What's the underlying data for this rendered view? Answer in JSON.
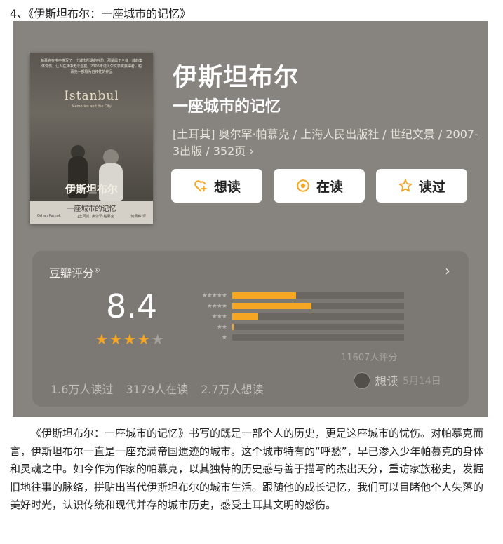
{
  "heading": "4、《伊斯坦布尔：一座城市的记忆》",
  "book": {
    "title": "伊斯坦布尔",
    "subtitle": "一座城市的记忆",
    "meta": "[土耳其] 奥尔罕·帕慕克 / 上海人民出版社 / 世纪文景 / 2007-3出版 / 352页",
    "meta_chevron": "›"
  },
  "cover": {
    "blurb": "帕慕克在书中描写了一个城市所谓的呼愁，那是属于全体一城的集体忧伤，让人在其中无法自拔。2006年诺贝尔文学奖获得者，帕慕克一部极为自传性的作品",
    "latin_title": "Istanbul",
    "latin_sub": "Memories and the City",
    "title": "伊斯坦布尔",
    "subtitle": "一座城市的记忆",
    "author_en": "Orhan Pamuk",
    "author_cn": "[土耳其] 奥尔罕·帕慕克",
    "translator": "何佩桦 译"
  },
  "buttons": [
    {
      "label": "想读",
      "icon": "heart-plus-icon"
    },
    {
      "label": "在读",
      "icon": "target-icon"
    },
    {
      "label": "读过",
      "icon": "star-outline-icon"
    }
  ],
  "rating": {
    "label": "豆瓣评分",
    "label_mark": "®",
    "chevron": "›",
    "score": "8.4",
    "stars_filled": 4,
    "stars_total": 5,
    "distribution": [
      {
        "stars": 5,
        "fraction": 0.37
      },
      {
        "stars": 4,
        "fraction": 0.46
      },
      {
        "stars": 3,
        "fraction": 0.15
      },
      {
        "stars": 2,
        "fraction": 0.01
      },
      {
        "stars": 1,
        "fraction": 0.0
      }
    ],
    "count": "11607人评分",
    "stats": [
      "1.6万人读过",
      "3179人在读",
      "2.7万人想读"
    ],
    "wish_text": "想读",
    "wish_date": "5月14日"
  },
  "colors": {
    "accent": "#f5a623",
    "card_bg": "#87837e",
    "rating_bg": "#7c7874"
  },
  "paragraph": "《伊斯坦布尔：一座城市的记忆》书写的既是一部个人的历史，更是这座城市的忧伤。对帕慕克而言，伊斯坦布尔一直是一座充满帝国遗迹的城市。这个城市特有的“呼愁”，早已渗入少年帕慕克的身体和灵魂之中。如今作为作家的帕慕克，以其独特的历史感与善于描写的杰出天分，重访家族秘史，发掘旧地往事的脉络，拼贴出当代伊斯坦布尔的城市生活。跟随他的成长记忆，我们可以目睹他个人失落的美好时光，认识传统和现代并存的城市历史，感受土耳其文明的感伤。"
}
